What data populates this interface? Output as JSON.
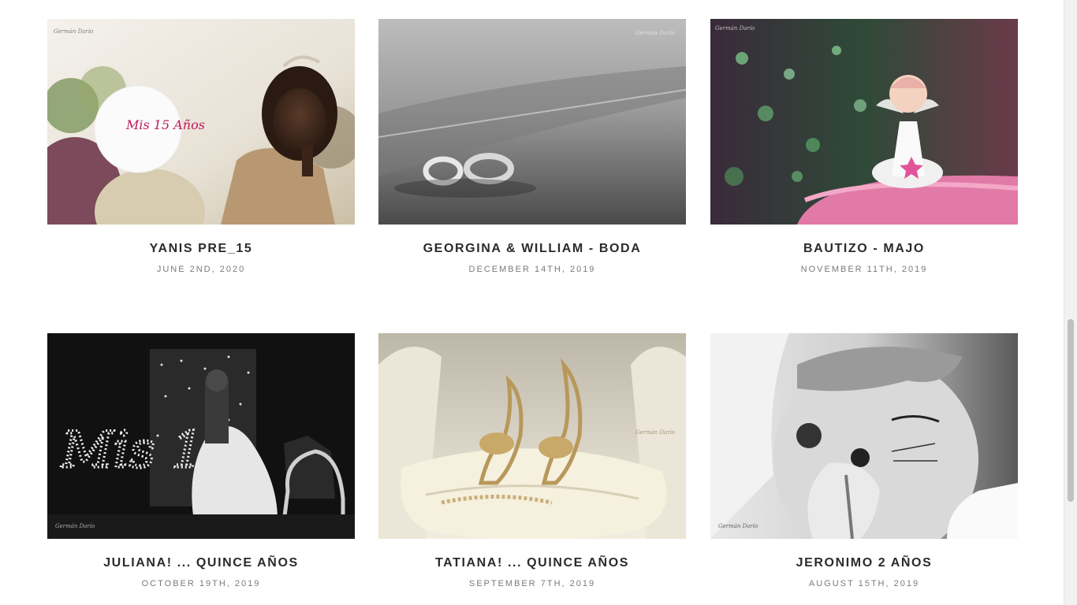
{
  "gallery": {
    "items": [
      {
        "title": "YANIS PRE_15",
        "date": "JUNE 2ND, 2020",
        "image": "quinceanera-balloons-photo",
        "balloon_text": "Mis 15 Años"
      },
      {
        "title": "GEORGINA & WILLIAM - BODA",
        "date": "DECEMBER 14TH, 2019",
        "image": "wedding-rings-sand-photo"
      },
      {
        "title": "BAUTIZO - MAJO",
        "date": "NOVEMBER 11TH, 2019",
        "image": "angel-cake-topper-photo"
      },
      {
        "title": "JULIANA! ... QUINCE AÑOS",
        "date": "OCTOBER 19TH, 2019",
        "image": "quinceanera-dance-photo",
        "sign_text": "Mis 15"
      },
      {
        "title": "TATIANA! ... QUINCE AÑOS",
        "date": "SEPTEMBER 7TH, 2019",
        "image": "gold-heels-pillow-photo"
      },
      {
        "title": "JERONIMO 2 AÑOS",
        "date": "AUGUST 15TH, 2019",
        "image": "child-face-painting-photo"
      }
    ]
  },
  "watermark": "Germán Darío",
  "colors": {
    "title": "#2b2b2b",
    "date": "#7a7a7a",
    "background": "#ffffff",
    "accent_pink": "#c2185b"
  }
}
